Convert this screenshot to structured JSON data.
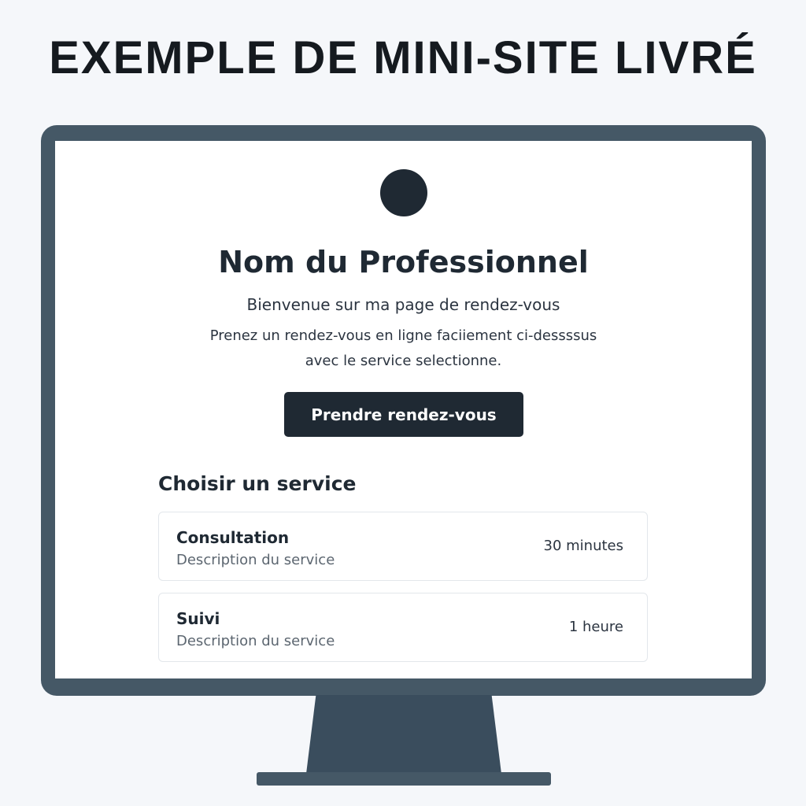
{
  "headline": "EXEMPLE DE MINI-SITE LIVRÉ",
  "site": {
    "professional_name": "Nom du Professionnel",
    "welcome": "Bienvenue sur ma page de rendez-vous",
    "intro_line1": "Prenez un rendez-vous en ligne faciiement ci-dessssus",
    "intro_line2": "avec le service selectionne.",
    "cta_label": "Prendre rendez-vous",
    "services_title": "Choisir un service",
    "services": [
      {
        "name": "Consultation",
        "description": "Description du service",
        "duration": "30 minutes"
      },
      {
        "name": "Suivi",
        "description": "Description du service",
        "duration": "1 heure"
      }
    ]
  },
  "colors": {
    "background": "#f5f7fa",
    "monitor": "#455866",
    "primary_dark": "#1f2933",
    "screen": "#ffffff"
  }
}
